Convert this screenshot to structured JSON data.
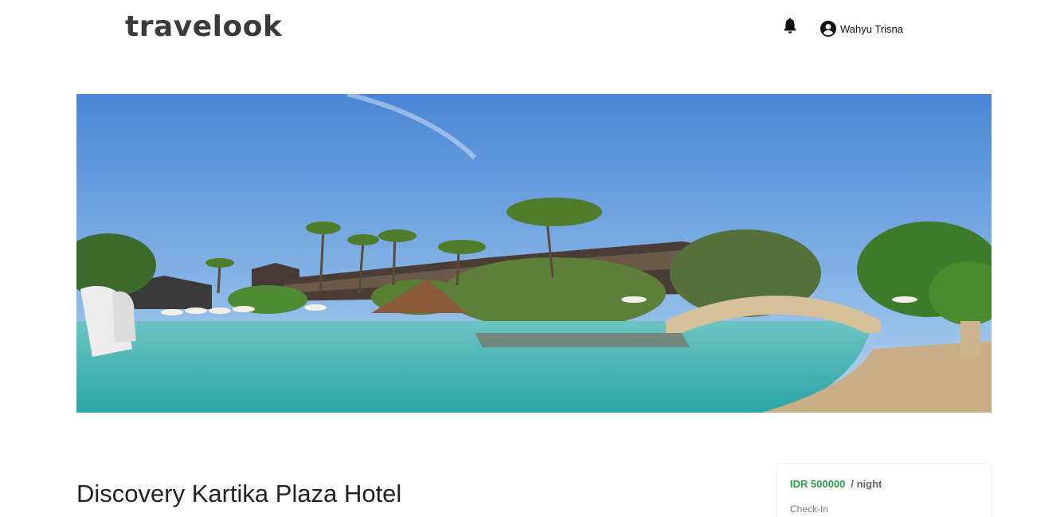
{
  "header": {
    "logo_text": "travelook",
    "notification_icon": "bell-icon",
    "user_icon": "account-circle-icon",
    "user_name": "Wahyu Trisna"
  },
  "hero": {
    "image": "resort-pool-photo"
  },
  "hotel": {
    "name": "Discovery Kartika Plaza Hotel"
  },
  "booking": {
    "price": "IDR 500000",
    "per_unit": "/ night",
    "checkin_label": "Check-In"
  },
  "colors": {
    "price_green": "#27a046",
    "sky_top": "#4a86d6",
    "pool": "#3fb3b0"
  }
}
